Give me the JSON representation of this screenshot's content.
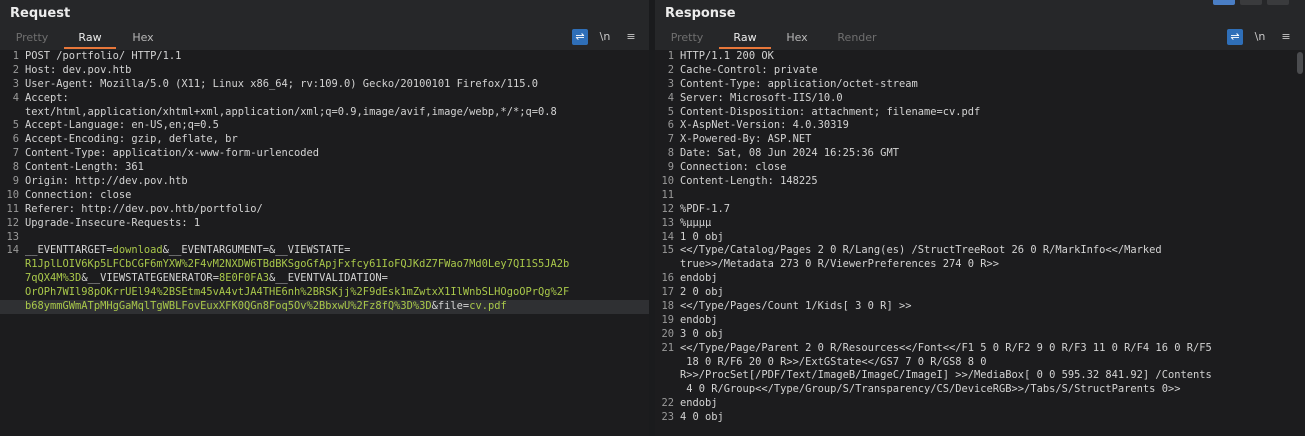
{
  "request": {
    "title": "Request",
    "tabs": [
      {
        "label": "Pretty",
        "active": false
      },
      {
        "label": "Raw",
        "active": true
      },
      {
        "label": "Hex",
        "active": false
      }
    ],
    "tools": {
      "newline": "\\n",
      "menu": "≡"
    },
    "lines": [
      {
        "n": "1",
        "text": "POST /portfolio/ HTTP/1.1"
      },
      {
        "n": "2",
        "text": "Host: dev.pov.htb"
      },
      {
        "n": "3",
        "text": "User-Agent: Mozilla/5.0 (X11; Linux x86_64; rv:109.0) Gecko/20100101 Firefox/115.0"
      },
      {
        "n": "4",
        "text": "Accept:"
      },
      {
        "n": "",
        "text": "text/html,application/xhtml+xml,application/xml;q=0.9,image/avif,image/webp,*/*;q=0.8"
      },
      {
        "n": "5",
        "text": "Accept-Language: en-US,en;q=0.5"
      },
      {
        "n": "6",
        "text": "Accept-Encoding: gzip, deflate, br"
      },
      {
        "n": "7",
        "text": "Content-Type: application/x-www-form-urlencoded"
      },
      {
        "n": "8",
        "text": "Content-Length: 361"
      },
      {
        "n": "9",
        "text": "Origin: http://dev.pov.htb"
      },
      {
        "n": "10",
        "text": "Connection: close"
      },
      {
        "n": "11",
        "text": "Referer: http://dev.pov.htb/portfolio/"
      },
      {
        "n": "12",
        "text": "Upgrade-Insecure-Requests: 1"
      },
      {
        "n": "13",
        "text": ""
      }
    ],
    "body": {
      "n": "14",
      "segments": [
        [
          {
            "t": "__EVENTTARGET",
            "c": "plain"
          },
          {
            "t": "=",
            "c": "plain"
          },
          {
            "t": "download",
            "c": "green"
          },
          {
            "t": "&",
            "c": "plain"
          },
          {
            "t": "__EVENTARGUMENT",
            "c": "plain"
          },
          {
            "t": "=&",
            "c": "plain"
          },
          {
            "t": "__VIEWSTATE",
            "c": "plain"
          },
          {
            "t": "=",
            "c": "plain"
          }
        ],
        [
          {
            "t": "R1JplLOIV6Kp5LFCbCGF6mYXW%2F4vM2NXDW6TBdBKSgoGfApjFxfcy61IoFQJKdZ7FWao7Md0Ley7QI1S5JA2b",
            "c": "green"
          }
        ],
        [
          {
            "t": "7qQX4M%3D",
            "c": "green"
          },
          {
            "t": "&",
            "c": "plain"
          },
          {
            "t": "__VIEWSTATEGENERATOR",
            "c": "plain"
          },
          {
            "t": "=",
            "c": "plain"
          },
          {
            "t": "8E0F0FA3",
            "c": "green"
          },
          {
            "t": "&",
            "c": "plain"
          },
          {
            "t": "__EVENTVALIDATION",
            "c": "plain"
          },
          {
            "t": "=",
            "c": "plain"
          }
        ],
        [
          {
            "t": "OrOPh7WIl98pOKrrUEl94%2BSEtm45vA4vtJA4THE6nh%2BRSKjj%2F9dEsk1mZwtxX1IlWnbSLHOgoOPrQg%2F",
            "c": "green"
          }
        ],
        [
          {
            "t": "b68ymmGWmATpMHgGaMqlTgWBLFovEuxXFK0QGn8Foq5Ov%2BbxwU%2Fz8fQ%3D%3D",
            "c": "green"
          },
          {
            "t": "&",
            "c": "plain"
          },
          {
            "t": "file",
            "c": "plain"
          },
          {
            "t": "=",
            "c": "plain"
          },
          {
            "t": "cv.pdf",
            "c": "green"
          }
        ]
      ]
    }
  },
  "response": {
    "title": "Response",
    "tabs": [
      {
        "label": "Pretty",
        "active": false
      },
      {
        "label": "Raw",
        "active": true
      },
      {
        "label": "Hex",
        "active": false
      },
      {
        "label": "Render",
        "active": false
      }
    ],
    "tools": {
      "newline": "\\n",
      "menu": "≡"
    },
    "lines": [
      {
        "n": "1",
        "text": "HTTP/1.1 200 OK"
      },
      {
        "n": "2",
        "text": "Cache-Control: private"
      },
      {
        "n": "3",
        "text": "Content-Type: application/octet-stream"
      },
      {
        "n": "4",
        "text": "Server: Microsoft-IIS/10.0"
      },
      {
        "n": "5",
        "text": "Content-Disposition: attachment; filename=cv.pdf"
      },
      {
        "n": "6",
        "text": "X-AspNet-Version: 4.0.30319"
      },
      {
        "n": "7",
        "text": "X-Powered-By: ASP.NET"
      },
      {
        "n": "8",
        "text": "Date: Sat, 08 Jun 2024 16:25:36 GMT"
      },
      {
        "n": "9",
        "text": "Connection: close"
      },
      {
        "n": "10",
        "text": "Content-Length: 148225"
      },
      {
        "n": "11",
        "text": ""
      },
      {
        "n": "12",
        "text": "%PDF-1.7"
      },
      {
        "n": "13",
        "text": "%µµµµ"
      },
      {
        "n": "14",
        "text": "1 0 obj"
      },
      {
        "n": "15",
        "text": "<</Type/Catalog/Pages 2 0 R/Lang(es) /StructTreeRoot 26 0 R/MarkInfo<</Marked"
      },
      {
        "n": "",
        "text": "true>>/Metadata 273 0 R/ViewerPreferences 274 0 R>>"
      },
      {
        "n": "16",
        "text": "endobj"
      },
      {
        "n": "17",
        "text": "2 0 obj"
      },
      {
        "n": "18",
        "text": "<</Type/Pages/Count 1/Kids[ 3 0 R] >>"
      },
      {
        "n": "19",
        "text": "endobj"
      },
      {
        "n": "20",
        "text": "3 0 obj"
      },
      {
        "n": "21",
        "text": "<</Type/Page/Parent 2 0 R/Resources<</Font<</F1 5 0 R/F2 9 0 R/F3 11 0 R/F4 16 0 R/F5"
      },
      {
        "n": "",
        "text": " 18 0 R/F6 20 0 R>>/ExtGState<</GS7 7 0 R/GS8 8 0"
      },
      {
        "n": "",
        "text": "R>>/ProcSet[/PDF/Text/ImageB/ImageC/ImageI] >>/MediaBox[ 0 0 595.32 841.92] /Contents"
      },
      {
        "n": "",
        "text": " 4 0 R/Group<</Type/Group/S/Transparency/CS/DeviceRGB>>/Tabs/S/StructParents 0>>"
      },
      {
        "n": "22",
        "text": "endobj"
      },
      {
        "n": "23",
        "text": "4 0 obj"
      }
    ]
  }
}
